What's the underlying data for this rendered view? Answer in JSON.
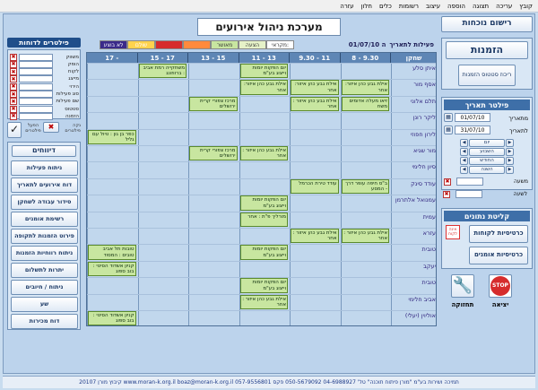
{
  "menubar": [
    "קובץ",
    "עריכה",
    "תצוגה",
    "הוספה",
    "עיצוב",
    "רשומות",
    "כלים",
    "חלון",
    "עזרה"
  ],
  "title": "מערכת ניהול אירועים",
  "attendance_button": "רישום נוכחות",
  "bookings": {
    "title": "הזמנות",
    "status_button": "ריכוז סטטוס הזמנות"
  },
  "legend": [
    {
      "label": "מקראי:",
      "color": "#ffffff"
    },
    {
      "label": "הצעה",
      "color": "#e6f2c8"
    },
    {
      "label": "מאושר",
      "color": "#c8e6a0"
    },
    {
      "label": "",
      "color": "#ff8a3c"
    },
    {
      "label": "",
      "color": "#d62c2c"
    },
    {
      "label": "שולם",
      "color": "#ffd34d"
    },
    {
      "label": "לא בוצע",
      "color": "#3a2a8a"
    }
  ],
  "activities_label": "פעילות לתאריך",
  "activities_date": "01/07/10 ה",
  "columns": [
    "8 - 9.30",
    "9.30 - 11",
    "11 - 13",
    "13 - 15",
    "15 - 17",
    "17 -"
  ],
  "room_header": "שחקן",
  "rows": [
    "איתן סלע",
    "אסף מור",
    "תלם אלוני",
    "ליקר רונן",
    "לירון חפוזי",
    "מור שגיא",
    "סיון חלימי",
    "עודד סינק",
    "עמנואל אלתרמן",
    "עמית",
    "עזרא",
    "טובית",
    "יעקב",
    "טובית",
    "אביב חלימי",
    "אוליוין (יעלי)"
  ],
  "events": [
    {
      "text": "אילת גבע כהן איזור: אחר",
      "row": 1,
      "col": 0
    },
    {
      "text": "אילת גבע כהן איזור: אחר",
      "row": 1,
      "col": 1
    },
    {
      "text": "אילת גבע כהן איזור: אחר",
      "row": 1,
      "col": 2
    },
    {
      "text": "יום הפקות יומות וייצוג בע\"מ",
      "row": 0,
      "col": 2
    },
    {
      "text": "משחקייה רמת אביב : ברווזונג",
      "row": 0,
      "col": 4
    },
    {
      "text": "זיאו מעלה אדומים משח",
      "row": 2,
      "col": 0
    },
    {
      "text": "אילת גבע כהן איזור : אחר",
      "row": 2,
      "col": 1
    },
    {
      "text": "מרכז צפורי קרית ירושלים",
      "row": 2,
      "col": 3
    },
    {
      "text": "כפר בן גון : טיול עם גליל",
      "row": 4,
      "col": 5
    },
    {
      "text": "מרכז צפורי קרית ירושלים",
      "row": 5,
      "col": 3
    },
    {
      "text": "אילת גבע כהן איזור : אחר",
      "row": 5,
      "col": 2
    },
    {
      "text": "ב\"ס חיפה עופר דרך - המסע",
      "row": 7,
      "col": 0
    },
    {
      "text": "עודד טירת הכרמל",
      "row": 7,
      "col": 1
    },
    {
      "text": "יום הפקות יומות וייצוג בע\"מ",
      "row": 8,
      "col": 2
    },
    {
      "text": "מורליך פ\"ת : אחר",
      "row": 9,
      "col": 2
    },
    {
      "text": "אילת גבע כהן איזור : אחר",
      "row": 10,
      "col": 0
    },
    {
      "text": "אילת גבע כהן איזור : אחר",
      "row": 10,
      "col": 1
    },
    {
      "text": "טובות תל אביב טובים : המסוד",
      "row": 11,
      "col": 5
    },
    {
      "text": "יום הפקות יומות וייצוג בע\"מ",
      "row": 11,
      "col": 2
    },
    {
      "text": "קניון אשדוד הסיטי : בוב ספוג",
      "row": 12,
      "col": 5
    },
    {
      "text": "יום הפקות יומות וייצוג בע\"מ",
      "row": 13,
      "col": 2
    },
    {
      "text": "אילת גבע כהן איזור : אחר",
      "row": 14,
      "col": 2
    },
    {
      "text": "קניון אשדוד הסיטי : בוב ספוג",
      "row": 15,
      "col": 5
    }
  ],
  "filters": {
    "title": "פילטרים לדוחות",
    "fields": [
      "משווק",
      "הופק",
      "לקוח",
      "מייצג",
      "הירוי",
      "סוג פעילות",
      "שם פעילות",
      "סטטוס",
      "הזמנה"
    ],
    "clear_label": "נקה פילטרים",
    "apply_label": "הפעל פילטרים"
  },
  "reports": {
    "title": "דיווחים",
    "buttons": [
      "ניתוח פעילות",
      "דוח אירועים לתאריך",
      "סידור עבודה לשחקן",
      "רשימת אומנים",
      "פירוט הזמנות לתקופה",
      "ניתוח רווחיות הזמנות",
      "יתרות לתשלום",
      "ניתוח / חיובים",
      "שע",
      "דוח מכירות"
    ]
  },
  "date_filter": {
    "title": "פילטר תאריך",
    "from_label": "מתאריך",
    "from_value": "01/07/10",
    "to_label": "לתאריך",
    "to_value": "31/07/10",
    "buttons": [
      "יום",
      "השבוע",
      "החודש",
      "השנה"
    ],
    "week_label": "משעה",
    "to_week_label": "לשעה"
  },
  "data_entry": {
    "title": "קליטת נתונים",
    "client_cards": "כרטיסיות לקוחות",
    "artist_cards": "כרטיסיות אומנים",
    "badge": "אינה לקוח"
  },
  "maintenance_label": "תחזוקה",
  "exit_label": "יציאה",
  "stop_label": "STOP",
  "footer": "תמיכה ושירות בע\"מ \"מורן פיתוח תוכנה\" טל' 04-6988927 050-5679092 פקס 057-9556801  www.moran-k.org.il  boaz@moran-k.org.il  קיבוץ מורן 20107"
}
